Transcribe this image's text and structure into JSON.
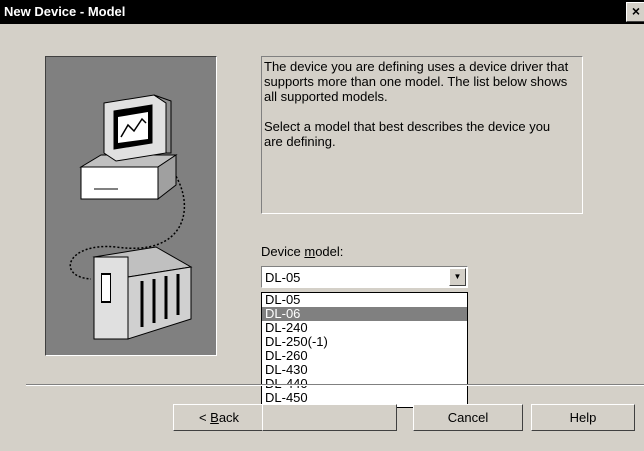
{
  "window": {
    "title": "New Device - Model",
    "close": "×"
  },
  "description": {
    "p1": "The device you are defining uses a device driver that supports more than one model.  The list below shows all supported models.",
    "p2": "Select  a model that best describes the device you are defining."
  },
  "device_model": {
    "label_pre": "Device ",
    "label_key": "m",
    "label_post": "odel:",
    "selected": "DL-05",
    "dropdown_arrow": "▼",
    "options": [
      "DL-05",
      "DL-06",
      "DL-240",
      "DL-250(-1)",
      "DL-260",
      "DL-430",
      "DL-440",
      "DL-450"
    ],
    "highlighted": "DL-06"
  },
  "buttons": {
    "back_pre": "< ",
    "back_key": "B",
    "back_post": "ack",
    "cancel": "Cancel",
    "help": "Help"
  },
  "icons": [
    "close-icon",
    "computer-icon",
    "plc-rack-icon",
    "dropdown-arrow-icon"
  ]
}
